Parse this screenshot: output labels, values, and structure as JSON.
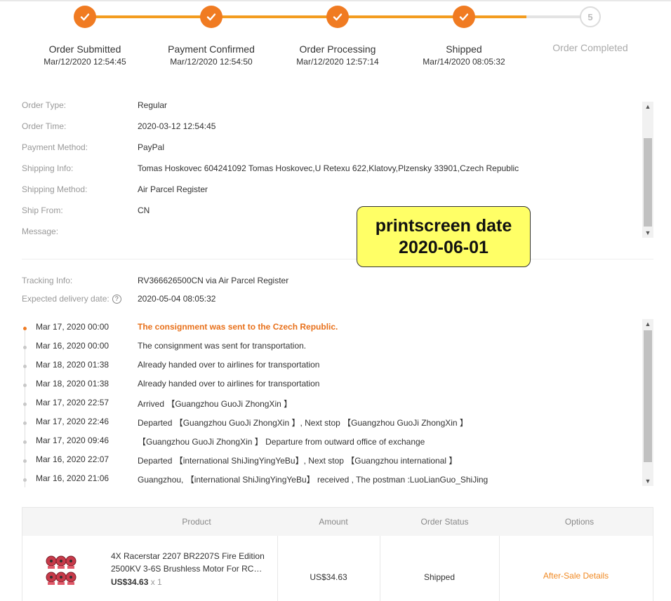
{
  "steps": [
    {
      "name": "Order Submitted",
      "date": "Mar/12/2020 12:54:45",
      "done": true
    },
    {
      "name": "Payment Confirmed",
      "date": "Mar/12/2020 12:54:50",
      "done": true
    },
    {
      "name": "Order Processing",
      "date": "Mar/12/2020 12:57:14",
      "done": true
    },
    {
      "name": "Shipped",
      "date": "Mar/14/2020 08:05:32",
      "done": true
    },
    {
      "name": "Order Completed",
      "date": "",
      "done": false,
      "number": "5"
    }
  ],
  "order_info": [
    {
      "label": "Order Type:",
      "value": "Regular"
    },
    {
      "label": "Order Time:",
      "value": "2020-03-12 12:54:45"
    },
    {
      "label": "Payment Method:",
      "value": "PayPal"
    },
    {
      "label": "Shipping Info:",
      "value": "Tomas Hoskovec 604241092 Tomas Hoskovec,U Retexu 622,Klatovy,Plzensky 33901,Czech Republic"
    },
    {
      "label": "Shipping Method:",
      "value": "Air Parcel Register"
    },
    {
      "label": "Ship From:",
      "value": "CN"
    },
    {
      "label": "Message:",
      "value": ""
    }
  ],
  "note": {
    "line1": "printscreen date",
    "line2": "2020-06-01"
  },
  "tracking": {
    "info_label": "Tracking Info:",
    "info_value": "RV366626500CN via Air Parcel Register",
    "delivery_label": "Expected delivery date:",
    "delivery_value": "2020-05-04 08:05:32"
  },
  "events": [
    {
      "time": "Mar 17, 2020 00:00",
      "desc": "The consignment was sent to the Czech Republic.",
      "latest": true
    },
    {
      "time": "Mar 16, 2020 00:00",
      "desc": "The consignment was sent for transportation."
    },
    {
      "time": "Mar 18, 2020 01:38",
      "desc": "Already handed over to airlines for transportation"
    },
    {
      "time": "Mar 18, 2020 01:38",
      "desc": "Already handed over to airlines for transportation"
    },
    {
      "time": "Mar 17, 2020 22:57",
      "desc": "Arrived 【Guangzhou GuoJi ZhongXin 】"
    },
    {
      "time": "Mar 17, 2020 22:46",
      "desc": "Departed 【Guangzhou GuoJi ZhongXin 】, Next stop 【Guangzhou GuoJi ZhongXin 】"
    },
    {
      "time": "Mar 17, 2020 09:46",
      "desc": "【Guangzhou GuoJi ZhongXin 】 Departure from outward office of exchange"
    },
    {
      "time": "Mar 16, 2020 22:07",
      "desc": "Departed 【international ShiJingYingYeBu】, Next stop 【Guangzhou international 】"
    },
    {
      "time": "Mar 16, 2020 21:06",
      "desc": "Guangzhou, 【international ShiJingYingYeBu】 received , The postman :LuoLianGuo_ShiJing"
    }
  ],
  "table": {
    "headers": {
      "product": "Product",
      "amount": "Amount",
      "status": "Order Status",
      "options": "Options"
    },
    "row": {
      "title": "4X Racerstar 2207 BR2207S Fire Edition 2500KV 3-6S Brushless Motor For RC…",
      "price": "US$34.63",
      "qty": "x 1",
      "amount": "US$34.63",
      "status": "Shipped",
      "option": "After-Sale Details"
    }
  },
  "colors": {
    "accent": "#f07b22",
    "track": "#f39c1f",
    "note": "#ffff66"
  }
}
